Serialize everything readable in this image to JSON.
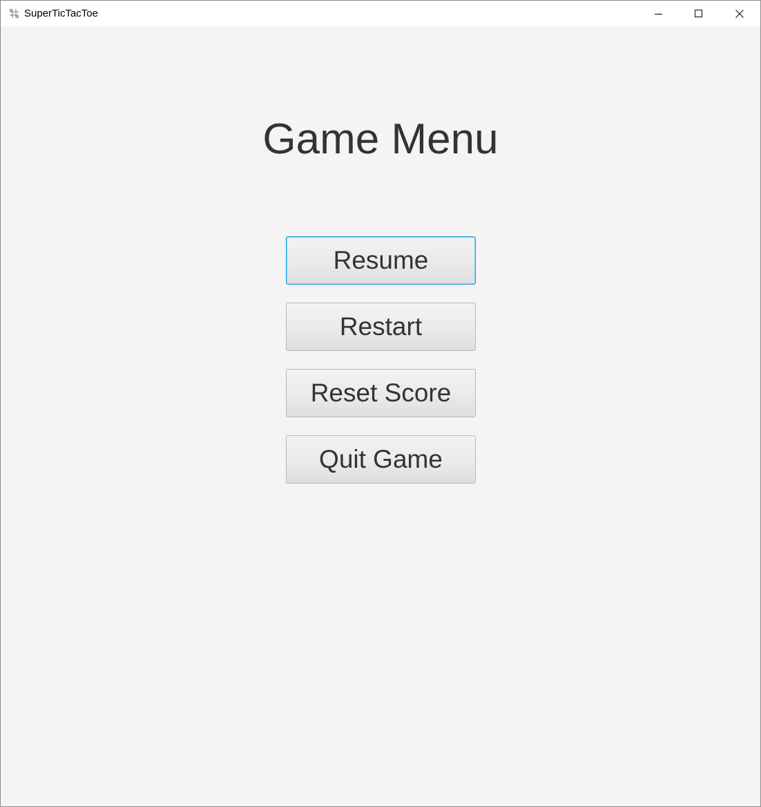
{
  "window": {
    "title": "SuperTicTacToe",
    "controls": {
      "minimize_icon": "minimize-icon",
      "maximize_icon": "maximize-icon",
      "close_icon": "close-icon"
    }
  },
  "menu": {
    "title": "Game Menu",
    "buttons": {
      "resume": "Resume",
      "restart": "Restart",
      "reset_score": "Reset Score",
      "quit_game": "Quit Game"
    },
    "focused_button": "resume"
  },
  "colors": {
    "background": "#f4f4f4",
    "text": "#333333",
    "focus_ring": "#1e9fe0"
  }
}
